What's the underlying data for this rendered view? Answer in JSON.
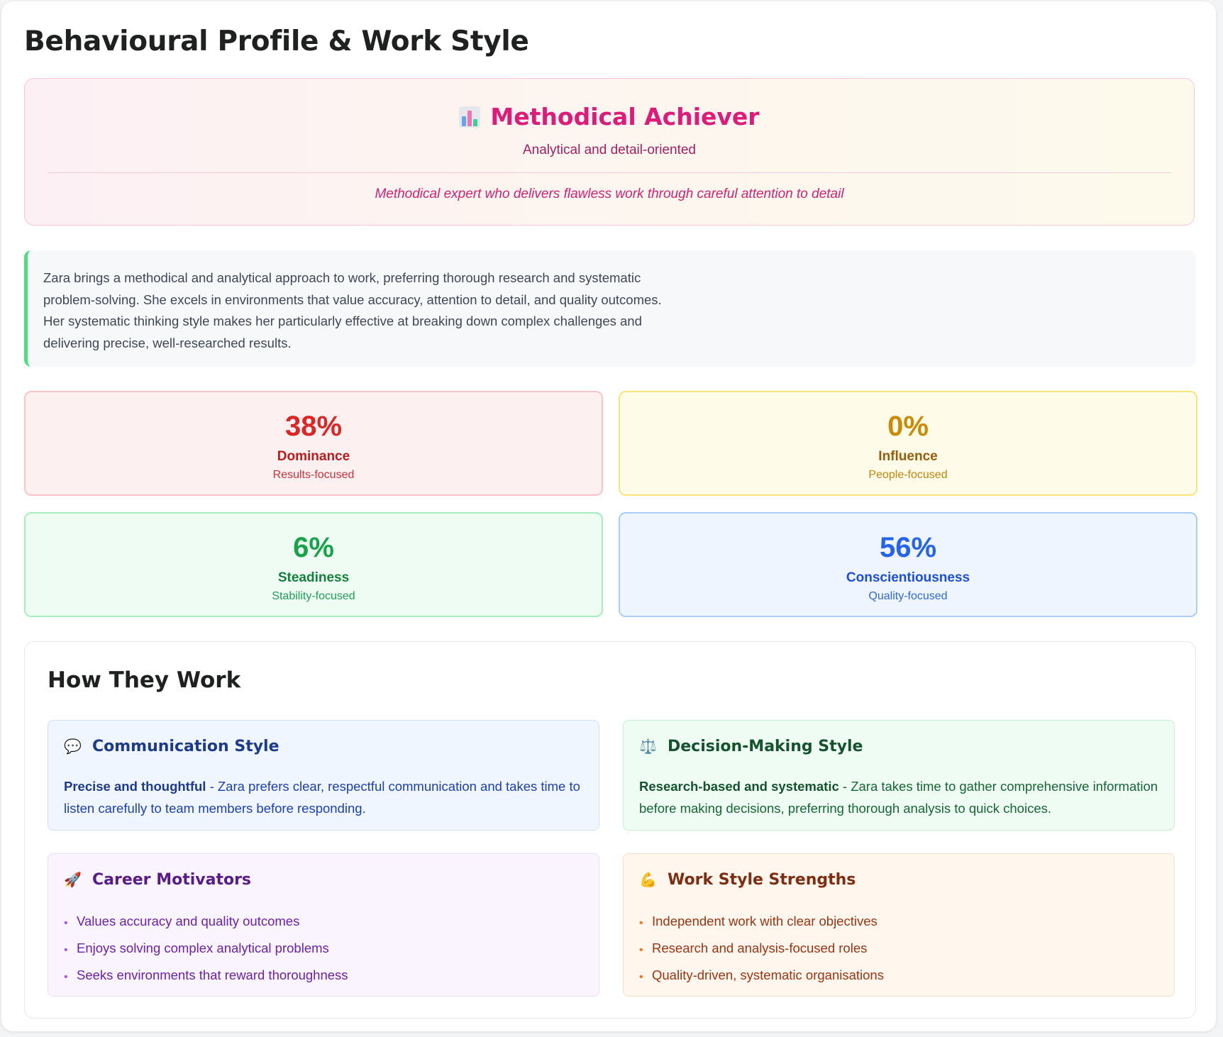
{
  "page": {
    "title": "Behavioural Profile & Work Style"
  },
  "profile": {
    "icon": "bar-chart-icon",
    "name": "Methodical Achiever",
    "subtitle": "Analytical and detail-oriented",
    "tagline": "Methodical expert who delivers flawless work through careful attention to detail"
  },
  "summary": {
    "text": "Zara brings a methodical and analytical approach to work, preferring thorough research and systematic problem-solving. She excels in environments that value accuracy, attention to detail, and quality outcomes. Her systematic thinking style makes her particularly effective at breaking down complex challenges and delivering precise, well-researched results.",
    "accent": "#4ade80"
  },
  "disc": [
    {
      "value": "38%",
      "name": "Dominance",
      "desc": "Results-focused",
      "color": "#dc2626"
    },
    {
      "value": "0%",
      "name": "Influence",
      "desc": "People-focused",
      "color": "#ca8a04"
    },
    {
      "value": "6%",
      "name": "Steadiness",
      "desc": "Stability-focused",
      "color": "#16a34a"
    },
    {
      "value": "56%",
      "name": "Conscientiousness",
      "desc": "Quality-focused",
      "color": "#2563eb"
    }
  ],
  "work": {
    "title": "How They Work",
    "communication": {
      "icon": "speech-bubble-icon",
      "title": "Communication Style",
      "lead": "Precise and thoughtful",
      "text": " - Zara prefers clear, respectful communication and takes time to listen carefully to team members before responding."
    },
    "decision": {
      "icon": "scales-icon",
      "title": "Decision-Making Style",
      "lead": "Research-based and systematic",
      "text": " - Zara takes time to gather comprehensive information before making decisions, preferring thorough analysis to quick choices."
    },
    "motivators": {
      "icon": "rocket-icon",
      "title": "Career Motivators",
      "items": [
        "Values accuracy and quality outcomes",
        "Enjoys solving complex analytical problems",
        "Seeks environments that reward thoroughness"
      ]
    },
    "strengths": {
      "icon": "flexed-bicep-icon",
      "title": "Work Style Strengths",
      "items": [
        "Independent work with clear objectives",
        "Research and analysis-focused roles",
        "Quality-driven, systematic organisations"
      ]
    }
  }
}
